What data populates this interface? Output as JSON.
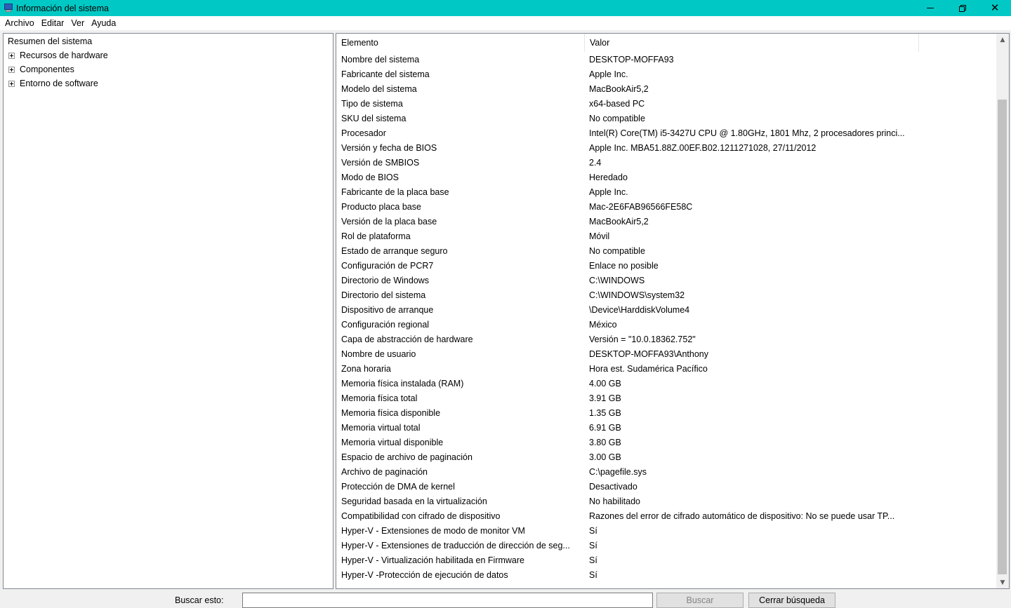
{
  "window": {
    "title": "Información del sistema"
  },
  "menu": [
    "Archivo",
    "Editar",
    "Ver",
    "Ayuda"
  ],
  "tree": {
    "root": "Resumen del sistema",
    "nodes": [
      "Recursos de hardware",
      "Componentes",
      "Entorno de software"
    ]
  },
  "list": {
    "headers": [
      "Elemento",
      "Valor"
    ],
    "rows": [
      [
        "Nombre del sistema",
        "DESKTOP-MOFFA93"
      ],
      [
        "Fabricante del sistema",
        "Apple Inc."
      ],
      [
        "Modelo del sistema",
        "MacBookAir5,2"
      ],
      [
        "Tipo de sistema",
        "x64-based PC"
      ],
      [
        "SKU del sistema",
        "No compatible"
      ],
      [
        "Procesador",
        "Intel(R) Core(TM) i5-3427U CPU @ 1.80GHz, 1801 Mhz, 2 procesadores princi..."
      ],
      [
        "Versión y fecha de BIOS",
        "Apple Inc. MBA51.88Z.00EF.B02.1211271028, 27/11/2012"
      ],
      [
        "Versión de SMBIOS",
        "2.4"
      ],
      [
        "Modo de BIOS",
        "Heredado"
      ],
      [
        "Fabricante de la placa base",
        "Apple Inc."
      ],
      [
        "Producto placa base",
        "Mac-2E6FAB96566FE58C"
      ],
      [
        "Versión de la placa base",
        "MacBookAir5,2"
      ],
      [
        "Rol de plataforma",
        "Móvil"
      ],
      [
        "Estado de arranque seguro",
        "No compatible"
      ],
      [
        "Configuración de PCR7",
        "Enlace no posible"
      ],
      [
        "Directorio de Windows",
        "C:\\WINDOWS"
      ],
      [
        "Directorio del sistema",
        "C:\\WINDOWS\\system32"
      ],
      [
        "Dispositivo de arranque",
        "\\Device\\HarddiskVolume4"
      ],
      [
        "Configuración regional",
        "México"
      ],
      [
        "Capa de abstracción de hardware",
        "Versión = \"10.0.18362.752\""
      ],
      [
        "Nombre de usuario",
        "DESKTOP-MOFFA93\\Anthony"
      ],
      [
        "Zona horaria",
        "Hora est. Sudamérica Pacífico"
      ],
      [
        "Memoria física instalada (RAM)",
        "4.00 GB"
      ],
      [
        "Memoria física total",
        "3.91 GB"
      ],
      [
        "Memoria física disponible",
        "1.35 GB"
      ],
      [
        "Memoria virtual total",
        "6.91 GB"
      ],
      [
        "Memoria virtual disponible",
        "3.80 GB"
      ],
      [
        "Espacio de archivo de paginación",
        "3.00 GB"
      ],
      [
        "Archivo de paginación",
        "C:\\pagefile.sys"
      ],
      [
        "Protección de DMA de kernel",
        "Desactivado"
      ],
      [
        "Seguridad basada en la virtualización",
        "No habilitado"
      ],
      [
        "Compatibilidad con cifrado de dispositivo",
        "Razones del error de cifrado automático de dispositivo: No se puede usar TP..."
      ],
      [
        "Hyper-V - Extensiones de modo de monitor VM",
        "Sí"
      ],
      [
        "Hyper-V - Extensiones de traducción de dirección de seg...",
        "Sí"
      ],
      [
        "Hyper-V - Virtualización habilitada en Firmware",
        "Sí"
      ],
      [
        "Hyper-V -Protección de ejecución de datos",
        "Sí"
      ]
    ]
  },
  "search": {
    "label": "Buscar esto:",
    "value": "",
    "find_button": "Buscar",
    "close_button": "Cerrar búsqueda"
  },
  "colors": {
    "titlebar": "#00c9c5",
    "scroll_thumb": "#c1c1c1"
  }
}
